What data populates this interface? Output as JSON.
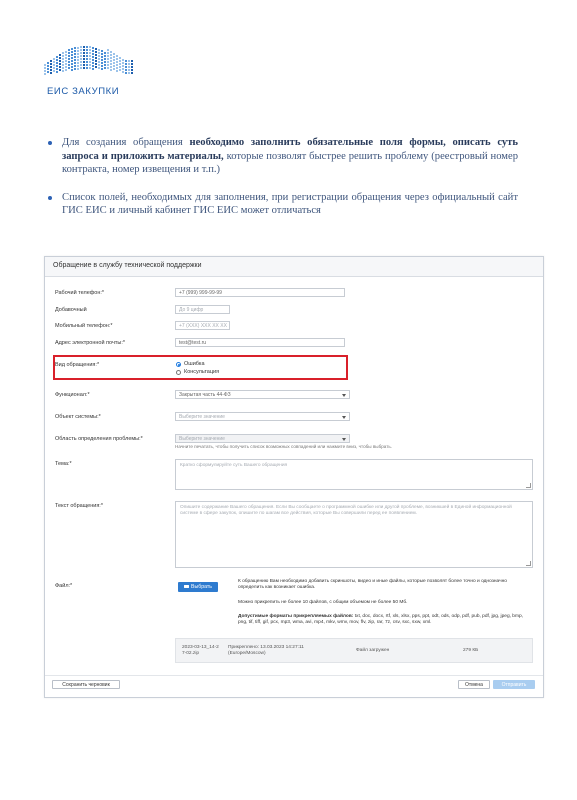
{
  "logo": {
    "text": "ЕИС ЗАКУПКИ"
  },
  "bullets": [
    {
      "pre": "Для создания обращения ",
      "bold": "необходимо заполнить обязательные поля формы, описать суть запроса и приложить материалы,",
      "post": " которые позволят быстрее решить проблему (реестровый номер контракта, номер извещения и т.п.)"
    },
    {
      "text": "Список полей, необходимых для заполнения, при регистрации обращения через официальный сайт ГИС ЕИС и личный кабинет ГИС ЕИС может отличаться"
    }
  ],
  "form": {
    "title": "Обращение в службу технической поддержки",
    "fields": {
      "work_phone": {
        "label": "Рабочий телефон:*",
        "value": "+7 (999) 999-99-99"
      },
      "extension": {
        "label": "Добавочный",
        "placeholder": "До 9 цифр"
      },
      "mobile": {
        "label": "Мобильный телефон:*",
        "placeholder": "+7 (XXX) XXX XX XX"
      },
      "email": {
        "label": "Адрес электронной почты:*",
        "value": "test@test.ru"
      },
      "request_type": {
        "label": "Вид обращения:*",
        "options": [
          "Ошибка",
          "Консультация"
        ],
        "selected": "Ошибка"
      },
      "functional": {
        "label": "Функционал:*",
        "value": "Закрытая часть 44-ФЗ"
      },
      "system_object": {
        "label": "Объект системы:*",
        "placeholder": "Выберите значение"
      },
      "problem_area": {
        "label": "Область определения проблемы:*",
        "placeholder": "Выберите значение",
        "hint": "Начните печатать, чтобы получить список возможных совпадений или нажмите вниз, чтобы выбрать."
      },
      "topic": {
        "label": "Тема:*",
        "placeholder": "Кратко сформулируйте суть Вашего обращения"
      },
      "body": {
        "label": "Текст обращения:*",
        "placeholder": "Опишите содержание Вашего обращения. Если Вы сообщаете о программной ошибке или другой проблеме, возникшей в Единой информационной системе в сфере закупок, опишите по шагам все действия, которые Вы совершили перед ее появлением."
      },
      "files": {
        "label": "Файл:*",
        "choose_label": "Выбрать",
        "info1": "К обращению Вам необходимо добавить скриншоты, видео и иные файлы, которые позволят более точно и однозначно определить как возникает ошибка.",
        "info2": "Можно прикрепить не более 10 файлов, с общим объемом не более 50 Мб.",
        "info3_bold": "Допустимые форматы прикрепляемых файлов:",
        "info3": " txt, doc, docx, rtf, xls, xlsx, pps, ppt, odt, ods, odp, pdf, pub, pdf, jpg, jpeg, bmp, png, tif, tiff, gif, pcx, mp3, wma, avi, mp4, mkv, wmv, mov, flv, zip, rar, 7z, csv, sxc, sxw, xml.",
        "file": {
          "name": "2023-03-13_14-27-02.zip",
          "attached": "Прикреплено: 13.03.2023 14:27:11 (Europe/Moscow)",
          "status": "Файл загружен",
          "size": "279 КБ"
        }
      }
    },
    "buttons": {
      "save_draft": "Сохранить черновик",
      "cancel": "Отмена",
      "submit": "Отправить"
    }
  }
}
